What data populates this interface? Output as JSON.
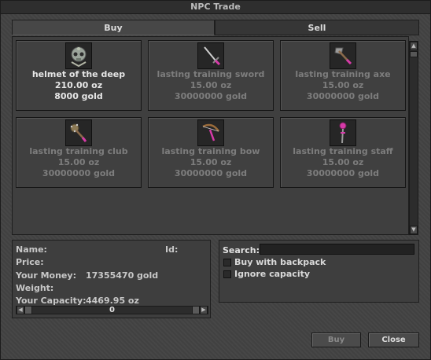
{
  "window": {
    "title": "NPC Trade"
  },
  "tabs": {
    "buy": "Buy",
    "sell": "Sell"
  },
  "items": [
    {
      "name": "helmet of the deep",
      "weight": "210.00 oz",
      "price": "8000 gold",
      "enabled": true,
      "icon": "helmet-icon"
    },
    {
      "name": "lasting training sword",
      "weight": "15.00 oz",
      "price": "30000000 gold",
      "enabled": false,
      "icon": "sword-icon"
    },
    {
      "name": "lasting training axe",
      "weight": "15.00 oz",
      "price": "30000000 gold",
      "enabled": false,
      "icon": "axe-icon"
    },
    {
      "name": "lasting training club",
      "weight": "15.00 oz",
      "price": "30000000 gold",
      "enabled": false,
      "icon": "club-icon"
    },
    {
      "name": "lasting training bow",
      "weight": "15.00 oz",
      "price": "30000000 gold",
      "enabled": false,
      "icon": "bow-icon"
    },
    {
      "name": "lasting training staff",
      "weight": "15.00 oz",
      "price": "30000000 gold",
      "enabled": false,
      "icon": "staff-icon"
    }
  ],
  "info": {
    "name_label": "Name:",
    "id_label": "Id:",
    "price_label": "Price:",
    "money_label": "Your Money:",
    "money_value": "17355470 gold",
    "weight_label": "Weight:",
    "capacity_label": "Your Capacity:",
    "capacity_value": "4469.95 oz",
    "amount_value": "0"
  },
  "search": {
    "label": "Search:",
    "value": "",
    "buy_with_backpack": "Buy with backpack",
    "ignore_capacity": "Ignore capacity"
  },
  "buttons": {
    "buy": "Buy",
    "close": "Close"
  },
  "colors": {
    "accent_pink": "#d63aa8",
    "enabled_text": "#e6e6e6",
    "disabled_text": "#7d7d7d"
  }
}
